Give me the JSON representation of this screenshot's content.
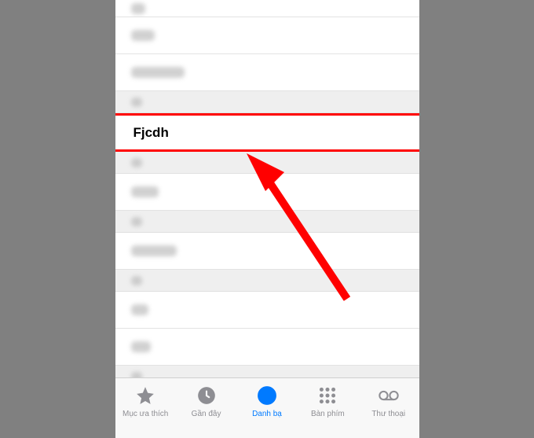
{
  "highlighted_contact": "Fjcdh",
  "tabs": {
    "favorites": "Mục ưa thích",
    "recents": "Gần đây",
    "contacts": "Danh bạ",
    "keypad": "Bàn phím",
    "voicemail": "Thư thoại"
  },
  "index_letters": [
    "Ô",
    "Ơ",
    "P"
  ]
}
